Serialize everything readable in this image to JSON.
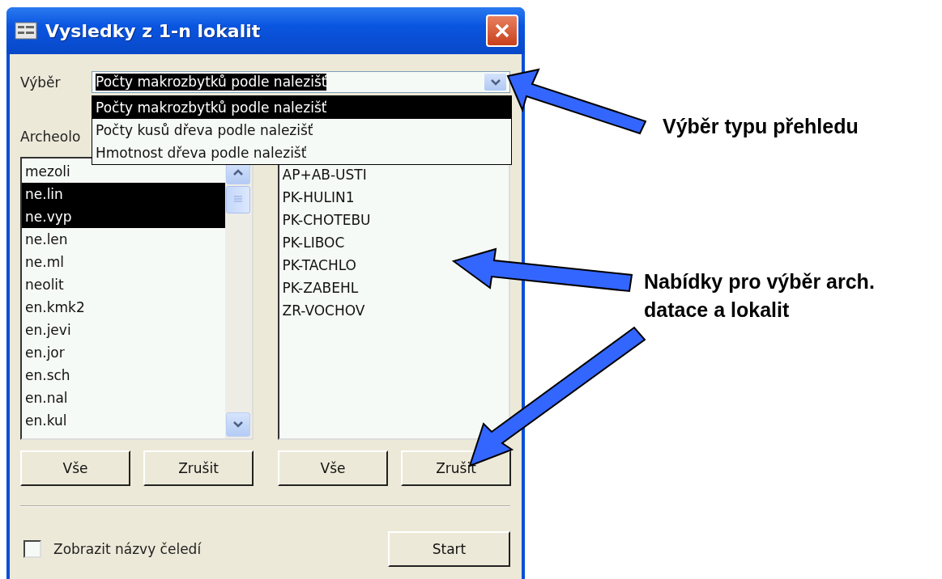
{
  "window": {
    "title": "Vysledky z 1-n lokalit"
  },
  "selection": {
    "label": "Výběr",
    "value": "Počty makrozbytků podle nalezišť",
    "options": [
      {
        "text": "Počty makrozbytků podle nalezišť",
        "selected": true
      },
      {
        "text": "Počty kusů dřeva podle nalezišť",
        "selected": false
      },
      {
        "text": "Hmotnost dřeva podle nalezišť",
        "selected": false
      }
    ]
  },
  "dating_list": {
    "label": "Archeolo",
    "items": [
      {
        "text": "mezoli",
        "selected": false
      },
      {
        "text": "ne.lin",
        "selected": true
      },
      {
        "text": "ne.vyp",
        "selected": true
      },
      {
        "text": "ne.len",
        "selected": false
      },
      {
        "text": "ne.ml",
        "selected": false
      },
      {
        "text": "neolit",
        "selected": false
      },
      {
        "text": "en.kmk2",
        "selected": false
      },
      {
        "text": "en.jevi",
        "selected": false
      },
      {
        "text": "en.jor",
        "selected": false
      },
      {
        "text": "en.sch",
        "selected": false
      },
      {
        "text": "en.nal",
        "selected": false
      },
      {
        "text": "en.kul",
        "selected": false
      }
    ]
  },
  "site_list": {
    "items": [
      {
        "text": "AP+AB-USTI",
        "selected": false
      },
      {
        "text": "PK-HULIN1",
        "selected": false
      },
      {
        "text": "PK-CHOTEBU",
        "selected": false
      },
      {
        "text": "PK-LIBOC",
        "selected": false
      },
      {
        "text": "PK-TACHLO",
        "selected": false
      },
      {
        "text": "PK-ZABEHL",
        "selected": false
      },
      {
        "text": "ZR-VOCHOV",
        "selected": false
      }
    ]
  },
  "dating_buttons": [
    "Vše",
    "Zrušit"
  ],
  "site_buttons": [
    "Vše",
    "Zrušit"
  ],
  "checkbox": {
    "label": "Zobrazit názvy čeledí",
    "checked": false
  },
  "start_button": "Start",
  "annotations": [
    {
      "text": "Výběr typu přehledu"
    },
    {
      "text": "Nabídky pro výběr arch. datace a lokalit"
    }
  ]
}
